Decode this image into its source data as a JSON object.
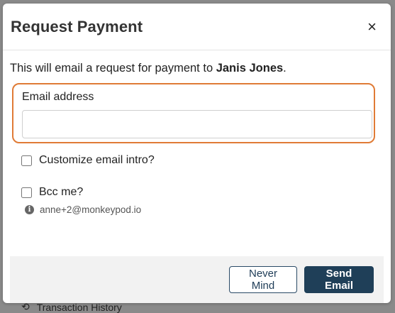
{
  "background": {
    "nav_item_label": "Transaction History",
    "nav_item_icon": "history-icon"
  },
  "modal": {
    "title": "Request Payment",
    "close_symbol": "×",
    "intro_prefix": "This will email a request for payment to ",
    "recipient_name": "Janis Jones",
    "intro_suffix": ".",
    "email_field": {
      "label": "Email address",
      "value": "",
      "placeholder": ""
    },
    "options": {
      "customize_intro": {
        "label": "Customize email intro?",
        "checked": false
      },
      "bcc_me": {
        "label": "Bcc me?",
        "checked": false
      }
    },
    "helper": {
      "icon": "info-icon",
      "text": "anne+2@monkeypod.io"
    },
    "buttons": {
      "cancel_label": "Never Mind",
      "submit_label": "Send Email"
    }
  },
  "colors": {
    "focus_ring": "#e07b36",
    "primary_button": "#1f3f58",
    "overlay": "#8a8a8a"
  }
}
